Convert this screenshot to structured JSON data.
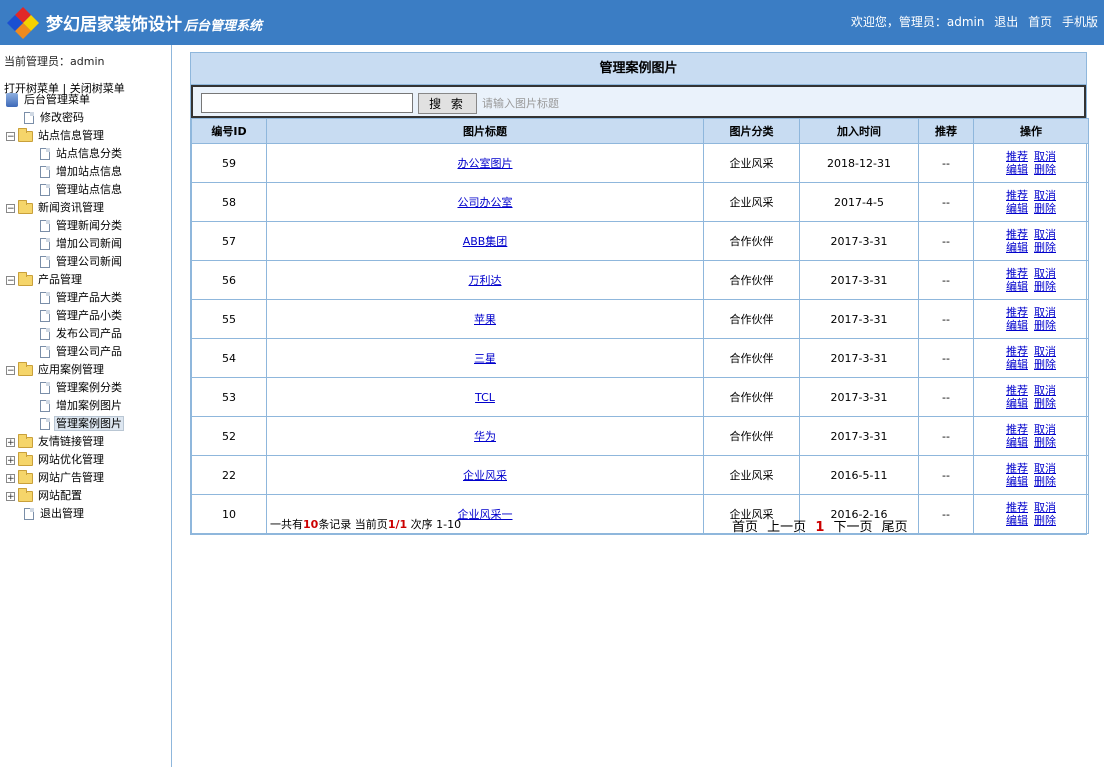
{
  "header": {
    "brand_main": "梦幻居家装饰设计",
    "brand_sub": "后台管理系统",
    "welcome": "欢迎您，管理员：admin",
    "links": [
      "退出",
      "首页",
      "手机版"
    ]
  },
  "sidebar": {
    "current_admin": "当前管理员：admin",
    "open_tree": "打开树菜单",
    "separator": "|",
    "close_tree": "关闭树菜单",
    "root_label": "后台管理菜单",
    "change_password": "修改密码",
    "groups": [
      {
        "label": "站点信息管理",
        "expanded": true,
        "items": [
          "站点信息分类",
          "增加站点信息",
          "管理站点信息"
        ]
      },
      {
        "label": "新闻资讯管理",
        "expanded": true,
        "items": [
          "管理新闻分类",
          "增加公司新闻",
          "管理公司新闻"
        ]
      },
      {
        "label": "产品管理",
        "expanded": true,
        "items": [
          "管理产品大类",
          "管理产品小类",
          "发布公司产品",
          "管理公司产品"
        ]
      },
      {
        "label": "应用案例管理",
        "expanded": true,
        "items": [
          "管理案例分类",
          "增加案例图片",
          "管理案例图片"
        ]
      },
      {
        "label": "友情链接管理",
        "expanded": false,
        "items": []
      },
      {
        "label": "网站优化管理",
        "expanded": false,
        "items": []
      },
      {
        "label": "网站广告管理",
        "expanded": false,
        "items": []
      },
      {
        "label": "网站配置",
        "expanded": false,
        "items": []
      }
    ],
    "logout": "退出管理",
    "active_item": "管理案例图片"
  },
  "main": {
    "title": "管理案例图片",
    "search": {
      "value": "",
      "button": "搜 索",
      "hint": "请输入图片标题"
    },
    "columns": [
      "编号ID",
      "图片标题",
      "图片分类",
      "加入时间",
      "推荐",
      "操作"
    ],
    "ops_labels": {
      "recommend": "推荐",
      "cancel": "取消",
      "edit": "编辑",
      "delete": "删除"
    },
    "rows": [
      {
        "id": "59",
        "title": "办公室图片",
        "category": "企业风采",
        "date": "2018-12-31",
        "recommend": "--"
      },
      {
        "id": "58",
        "title": "公司办公室",
        "category": "企业风采",
        "date": "2017-4-5",
        "recommend": "--"
      },
      {
        "id": "57",
        "title": "ABB集团",
        "category": "合作伙伴",
        "date": "2017-3-31",
        "recommend": "--"
      },
      {
        "id": "56",
        "title": "万利达",
        "category": "合作伙伴",
        "date": "2017-3-31",
        "recommend": "--"
      },
      {
        "id": "55",
        "title": "苹果",
        "category": "合作伙伴",
        "date": "2017-3-31",
        "recommend": "--"
      },
      {
        "id": "54",
        "title": "三星",
        "category": "合作伙伴",
        "date": "2017-3-31",
        "recommend": "--"
      },
      {
        "id": "53",
        "title": "TCL",
        "category": "合作伙伴",
        "date": "2017-3-31",
        "recommend": "--"
      },
      {
        "id": "52",
        "title": "华为",
        "category": "合作伙伴",
        "date": "2017-3-31",
        "recommend": "--"
      },
      {
        "id": "22",
        "title": "企业风采",
        "category": "企业风采",
        "date": "2016-5-11",
        "recommend": "--"
      },
      {
        "id": "10",
        "title": "企业风采一",
        "category": "企业风采",
        "date": "2016-2-16",
        "recommend": "--"
      }
    ],
    "summary": {
      "prefix": "一共有",
      "total": "10",
      "mid": "条记录 当前页",
      "page": "1/1",
      "suffix": " 次序 1-10"
    },
    "pager": {
      "first": "首页",
      "prev": "上一页",
      "current": "1",
      "next": "下一页",
      "last": "尾页"
    }
  }
}
